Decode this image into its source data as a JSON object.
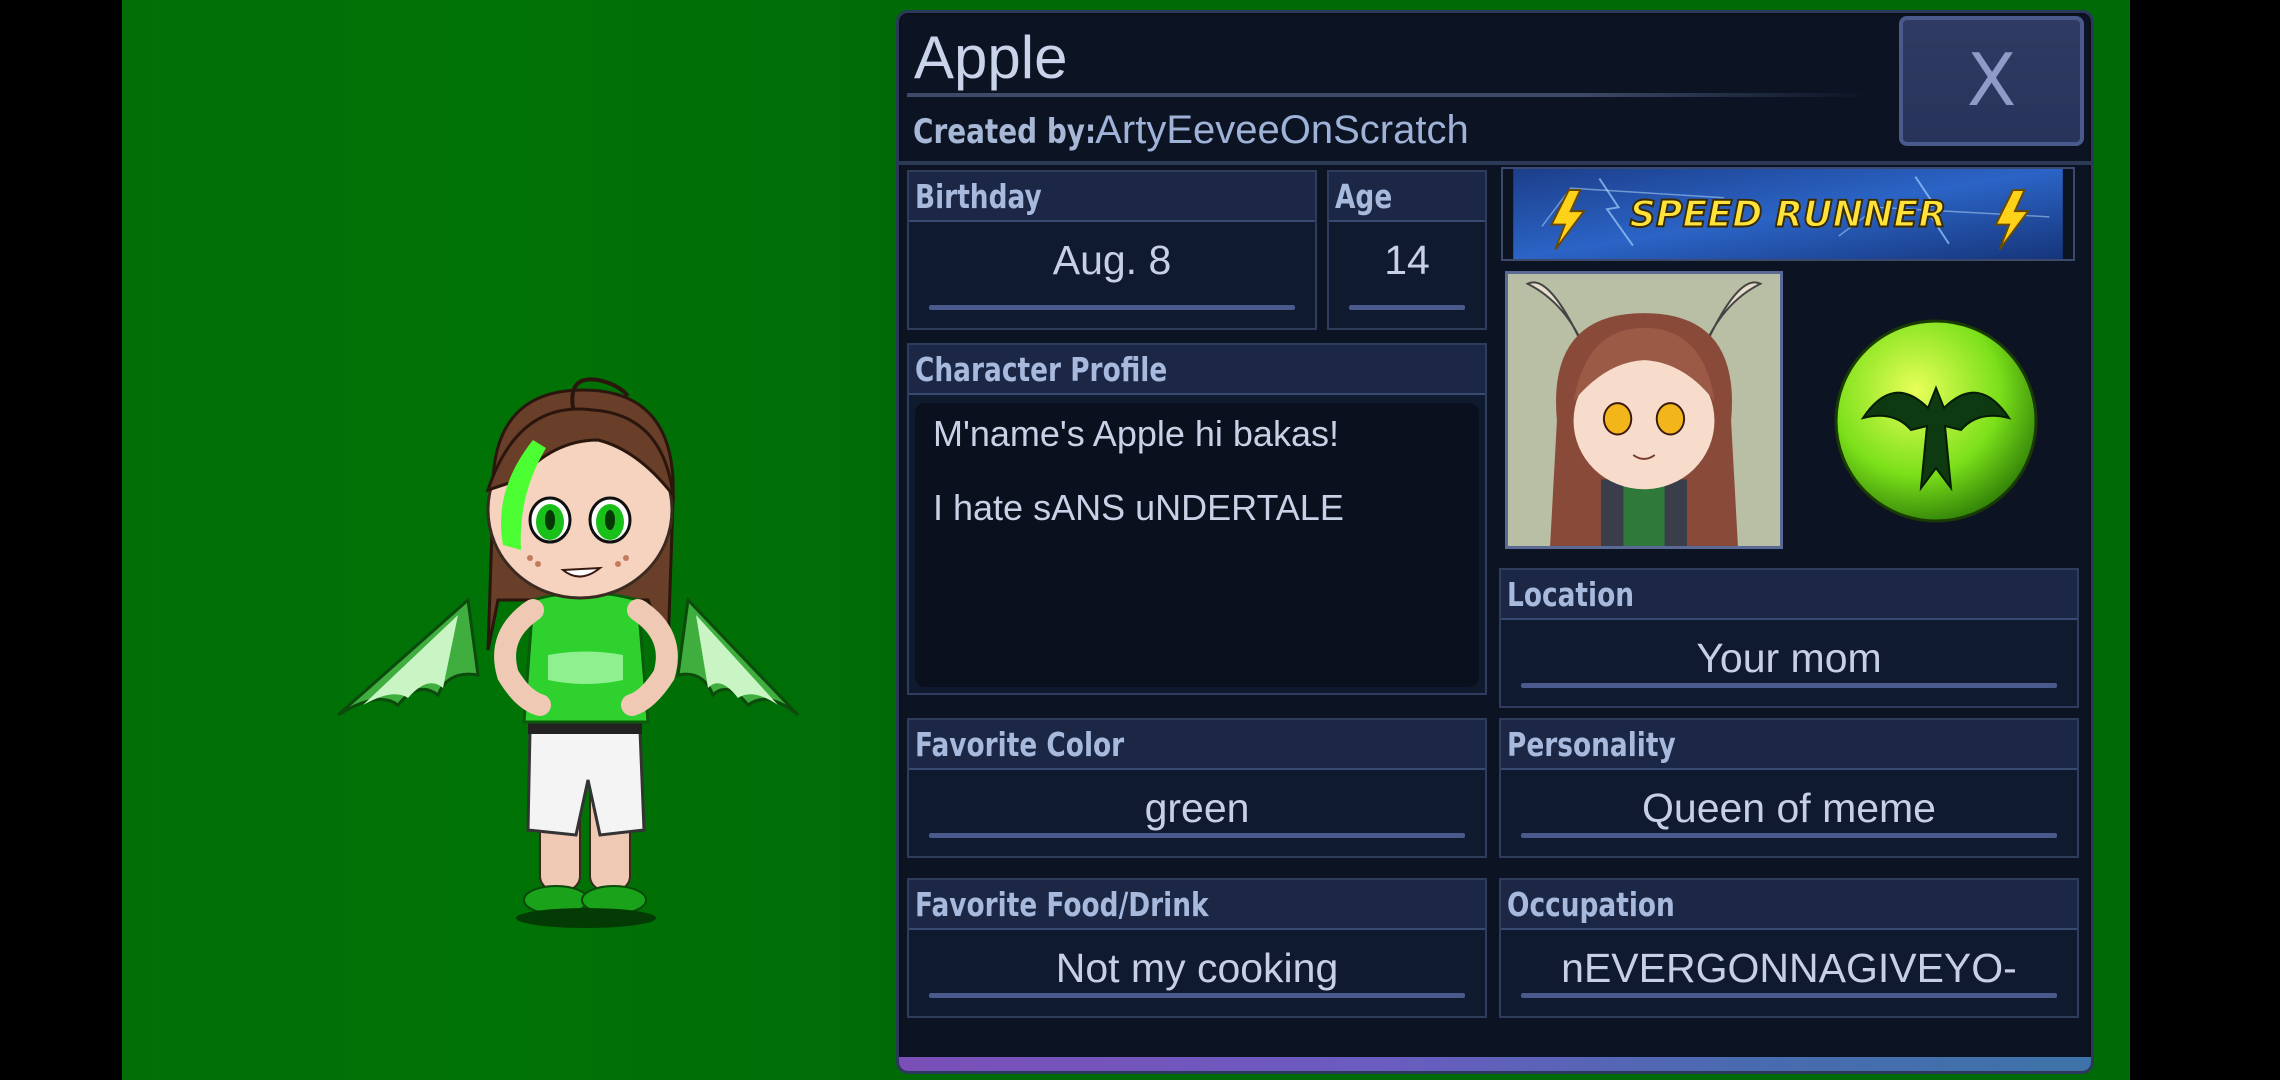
{
  "profile": {
    "name": "Apple",
    "created_by_label": "Created by:",
    "created_by": "ArtyEeveeOnScratch",
    "close_label": "X"
  },
  "fields": {
    "birthday": {
      "label": "Birthday",
      "value": "Aug. 8"
    },
    "age": {
      "label": "Age",
      "value": "14"
    },
    "character_profile": {
      "label": "Character Profile",
      "line1": "M'name's Apple hi bakas!",
      "line2": "I hate sANS uNDERTALE"
    },
    "location": {
      "label": "Location",
      "value": "Your mom"
    },
    "favorite_color": {
      "label": "Favorite Color",
      "value": "green"
    },
    "personality": {
      "label": "Personality",
      "value": "Queen of meme"
    },
    "favorite_food": {
      "label": "Favorite Food/Drink",
      "value": "Not my cooking"
    },
    "occupation": {
      "label": "Occupation",
      "value": "nEVERGONNAGIVEYO-"
    }
  },
  "banner": {
    "text": "SPEED RUNNER",
    "icon": "lightning-bolt-icon"
  },
  "badge": {
    "icon": "dragon-emblem-icon",
    "color": "#7be01a"
  },
  "colors": {
    "background": "#006b06",
    "panel": "#0c1424",
    "header": "#1c2746",
    "accent": "#4a5a8c",
    "text": "#c6cfe6"
  }
}
